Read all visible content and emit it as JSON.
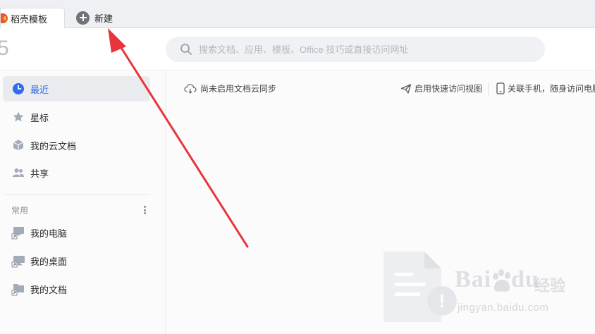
{
  "tabs": {
    "active_label": "稻壳模板",
    "new_tab_label": "新建"
  },
  "header": {
    "brand_fragment": "5",
    "search_placeholder": "搜索文档、应用、模板、Office 技巧或直接访问网址"
  },
  "sidebar": {
    "items": [
      {
        "label": "最近",
        "icon": "clock-icon",
        "active": true
      },
      {
        "label": "星标",
        "icon": "star-icon"
      },
      {
        "label": "我的云文档",
        "icon": "cloud-box-icon"
      },
      {
        "label": "共享",
        "icon": "people-icon"
      }
    ],
    "section_title": "常用",
    "common": [
      {
        "label": "我的电脑",
        "icon": "computer-shortcut-icon"
      },
      {
        "label": "我的桌面",
        "icon": "desktop-shortcut-icon"
      },
      {
        "label": "我的文档",
        "icon": "folder-shortcut-icon"
      }
    ]
  },
  "main": {
    "sync_label": "尚未启用文档云同步",
    "quick_view_label": "启用快速访问视图",
    "phone_label": "关联手机，随身访问电脑文档"
  },
  "watermark": {
    "brand": "Bai",
    "brand_tail": "du",
    "cn": "经验",
    "url": "jingyan.baidu.com"
  },
  "colors": {
    "accent": "#2f6cf0",
    "arrow": "#e8343a",
    "tab_logo": "#e8582b"
  }
}
